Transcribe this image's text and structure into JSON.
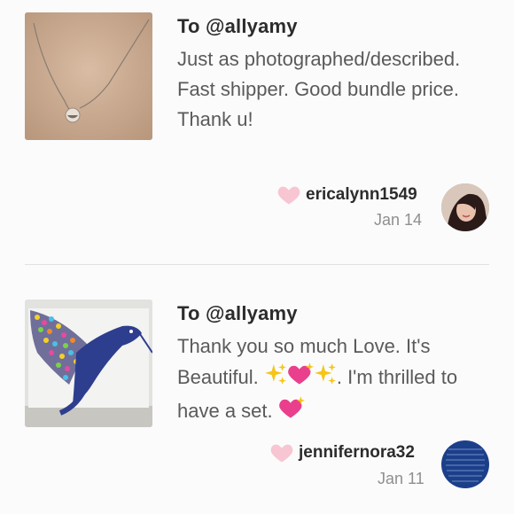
{
  "reviews": [
    {
      "title": "To @allyamy",
      "body": "Just as photographed/described. Fast shipper. Good bundle price. Thank u!",
      "username": "ericalynn1549",
      "date": "Jan 14"
    },
    {
      "title": "To @allyamy",
      "body_parts": [
        "Thank you so much Love. It's Beautiful. ",
        ". I'm thrilled to have a set. "
      ],
      "username": "jennifernora32",
      "date": "Jan 11"
    }
  ],
  "icons": {
    "heart": "heart-icon",
    "sparkles": "sparkles-icon",
    "sparkling_heart": "sparkling-heart-icon"
  },
  "colors": {
    "heart": "#f7c6d2",
    "divider": "#e0e0e0"
  }
}
